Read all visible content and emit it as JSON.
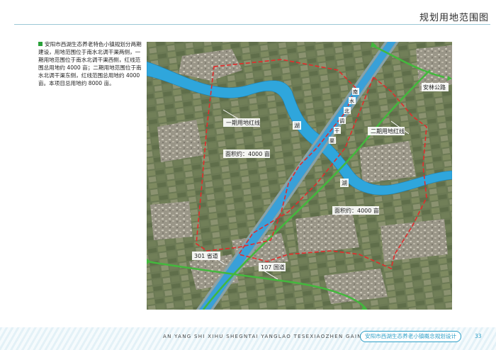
{
  "header": {
    "title": "规划用地范围图"
  },
  "description": {
    "text": "安阳市西湖生态养老特色小镇规划分两期建设，用地范围位于南水北调干渠两侧，一期用地范围位于南水北调干渠西侧，红线范围总用地约 4000 亩；二期用地范围位于南水北调干渠东侧，红线范围总用地约 4000 亩。本项目总用地约 8000 亩。"
  },
  "map": {
    "labels": {
      "phase1_redline": "一期用地红线",
      "phase2_redline": "二期用地红线",
      "phase1_area": "面积约：4000 亩",
      "phase2_area": "面积约：4000 亩",
      "road_anlin": "安林公路",
      "road_301": "301 省道",
      "road_107": "107 国道",
      "lake_1": "湖",
      "lake_2": "湖",
      "canal_chars": [
        "南",
        "水",
        "北",
        "调",
        "干",
        "渠"
      ]
    },
    "colors": {
      "water": "#2fa6dc",
      "redline": "#e32b2b",
      "road": "#43b83d",
      "canal": "#3aa0d8"
    }
  },
  "footer": {
    "pinyin": "AN YANG SHI XIHU SHEGNTAI YANGLAO TESEXIAOZHEN GAINIANGUIHUA",
    "project": "安阳市西湖生态养老小镇概念规划设计",
    "page": "33"
  }
}
